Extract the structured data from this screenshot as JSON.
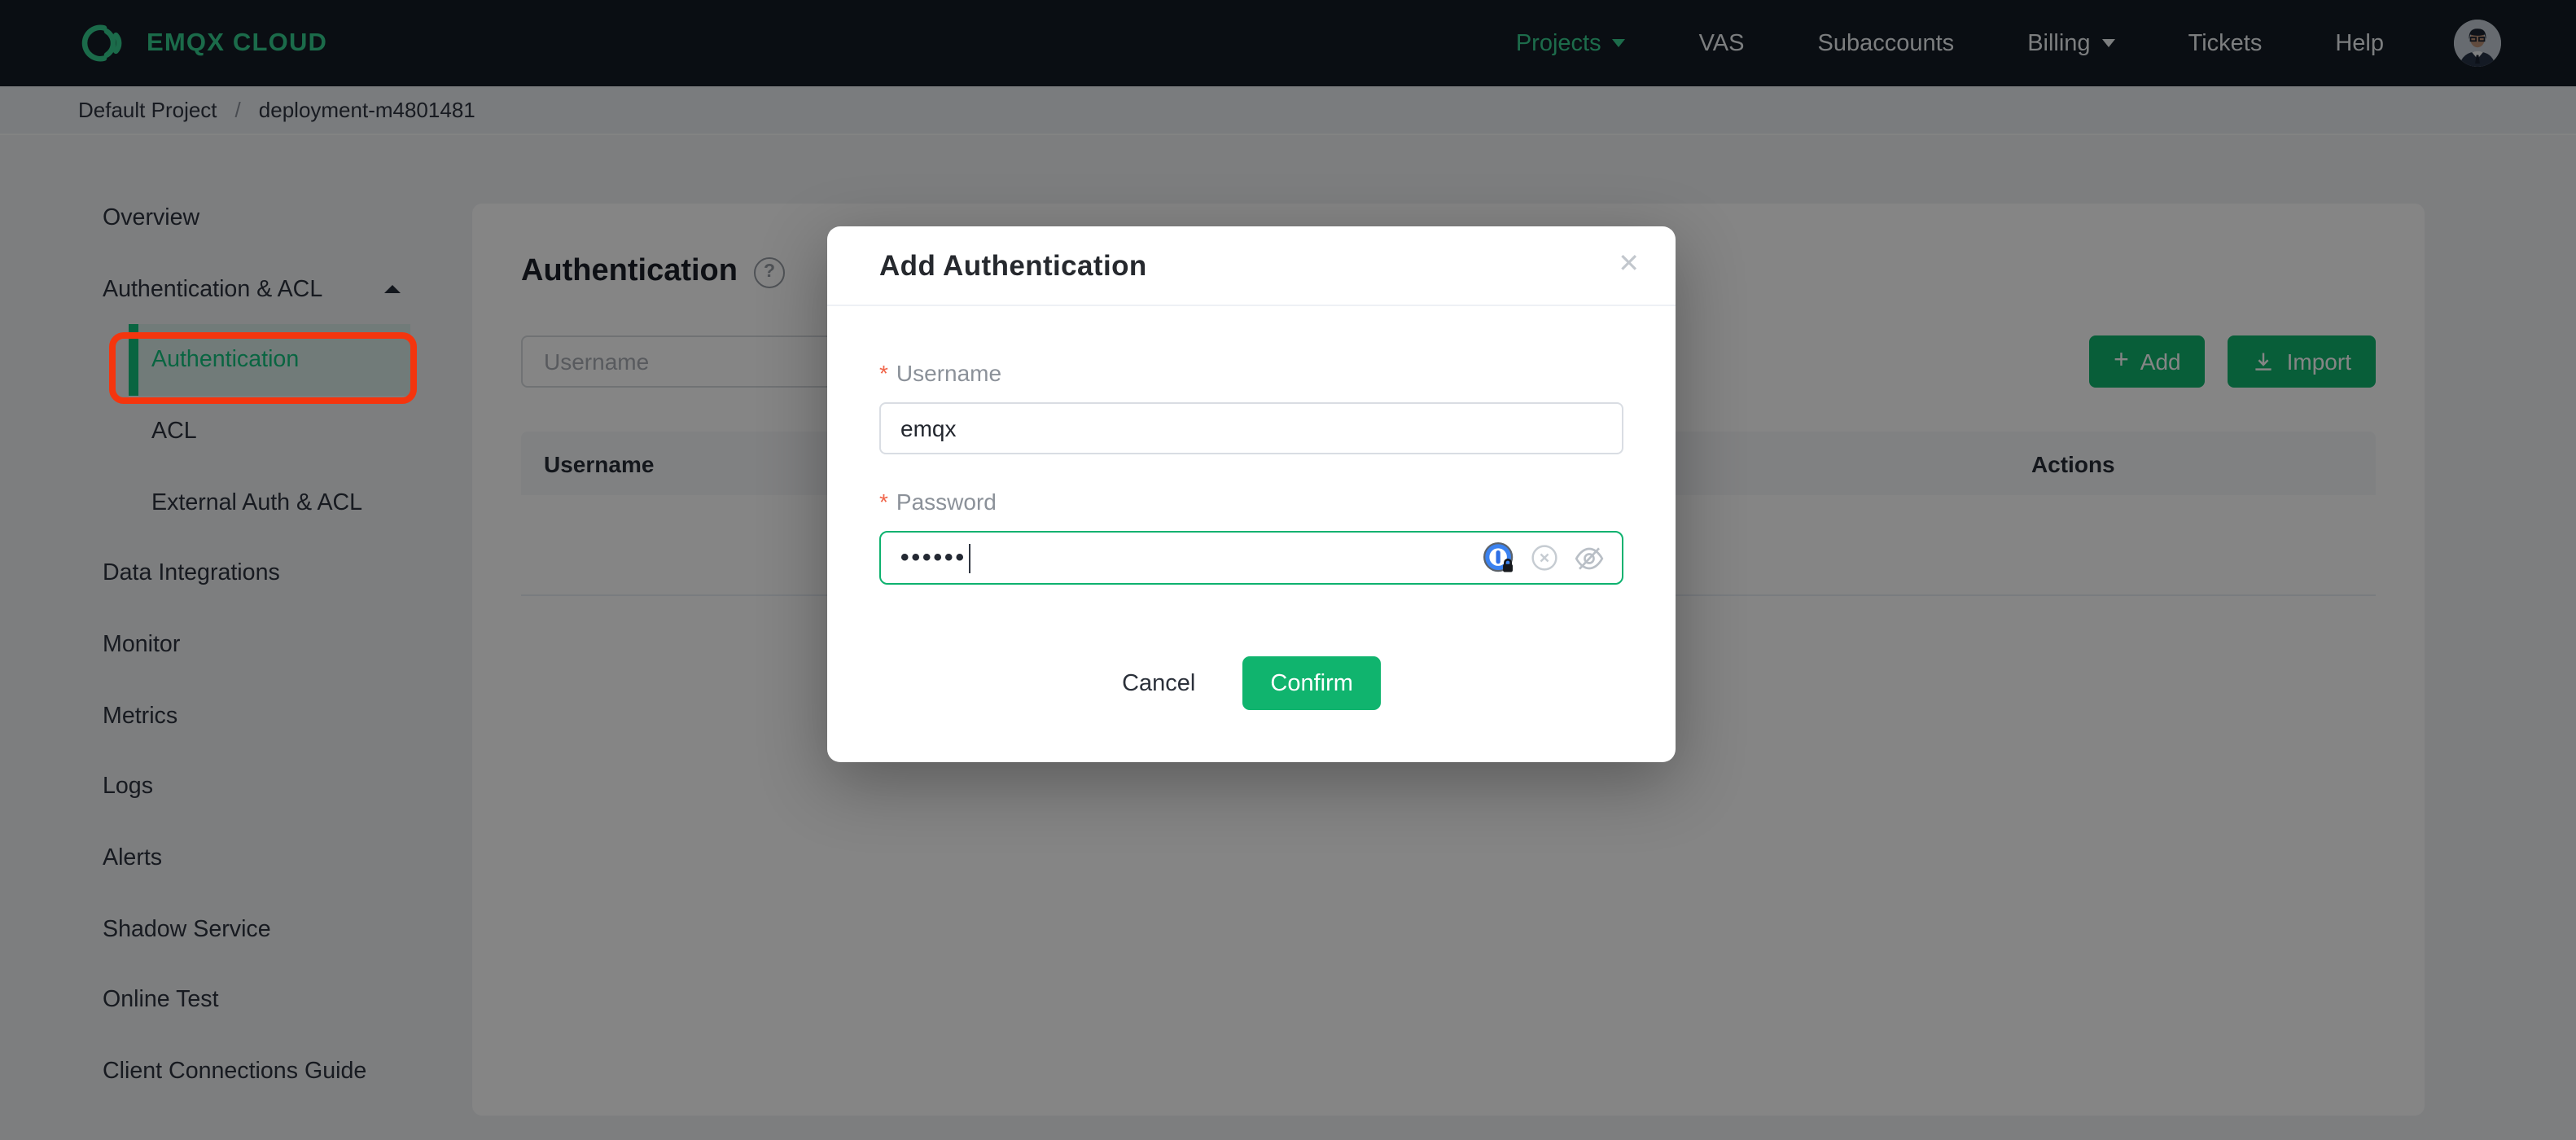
{
  "navbar": {
    "logo_text": "EMQX CLOUD",
    "items": [
      {
        "label": "Projects",
        "active": true,
        "has_caret": true
      },
      {
        "label": "VAS"
      },
      {
        "label": "Subaccounts"
      },
      {
        "label": "Billing",
        "has_caret": true
      },
      {
        "label": "Tickets"
      },
      {
        "label": "Help"
      }
    ]
  },
  "breadcrumb": {
    "items": [
      "Default Project",
      "deployment-m4801481"
    ],
    "separator": "/"
  },
  "sidebar": {
    "items": [
      {
        "label": "Overview"
      },
      {
        "label": "Authentication & ACL",
        "expanded": true
      },
      {
        "label": "Authentication",
        "submenu": true,
        "active": true,
        "annotated": true
      },
      {
        "label": "ACL",
        "submenu": true
      },
      {
        "label": "External Auth & ACL",
        "submenu": true
      },
      {
        "label": "Data Integrations"
      },
      {
        "label": "Monitor"
      },
      {
        "label": "Metrics"
      },
      {
        "label": "Logs"
      },
      {
        "label": "Alerts"
      },
      {
        "label": "Shadow Service"
      },
      {
        "label": "Online Test"
      },
      {
        "label": "Client Connections Guide"
      }
    ]
  },
  "main": {
    "title": "Authentication",
    "help_glyph": "?",
    "search_placeholder": "Username",
    "add_button": "Add",
    "import_button": "Import",
    "table": {
      "columns": [
        "Username",
        "Actions"
      ],
      "rows": []
    }
  },
  "modal": {
    "title": "Add Authentication",
    "close_glyph": "✕",
    "username_label": "Username",
    "username_value": "emqx",
    "password_label": "Password",
    "password_masked": "••••••",
    "required_marker": "*",
    "cancel_button": "Cancel",
    "confirm_button": "Confirm"
  },
  "colors": {
    "brand_green": "#35cd8e",
    "button_green": "#10b46e",
    "sidebar_active_green": "#12c27e",
    "annotation_red": "#f4350e",
    "navbar_bg": "#141c26",
    "password_border_green": "#0eb26f"
  }
}
